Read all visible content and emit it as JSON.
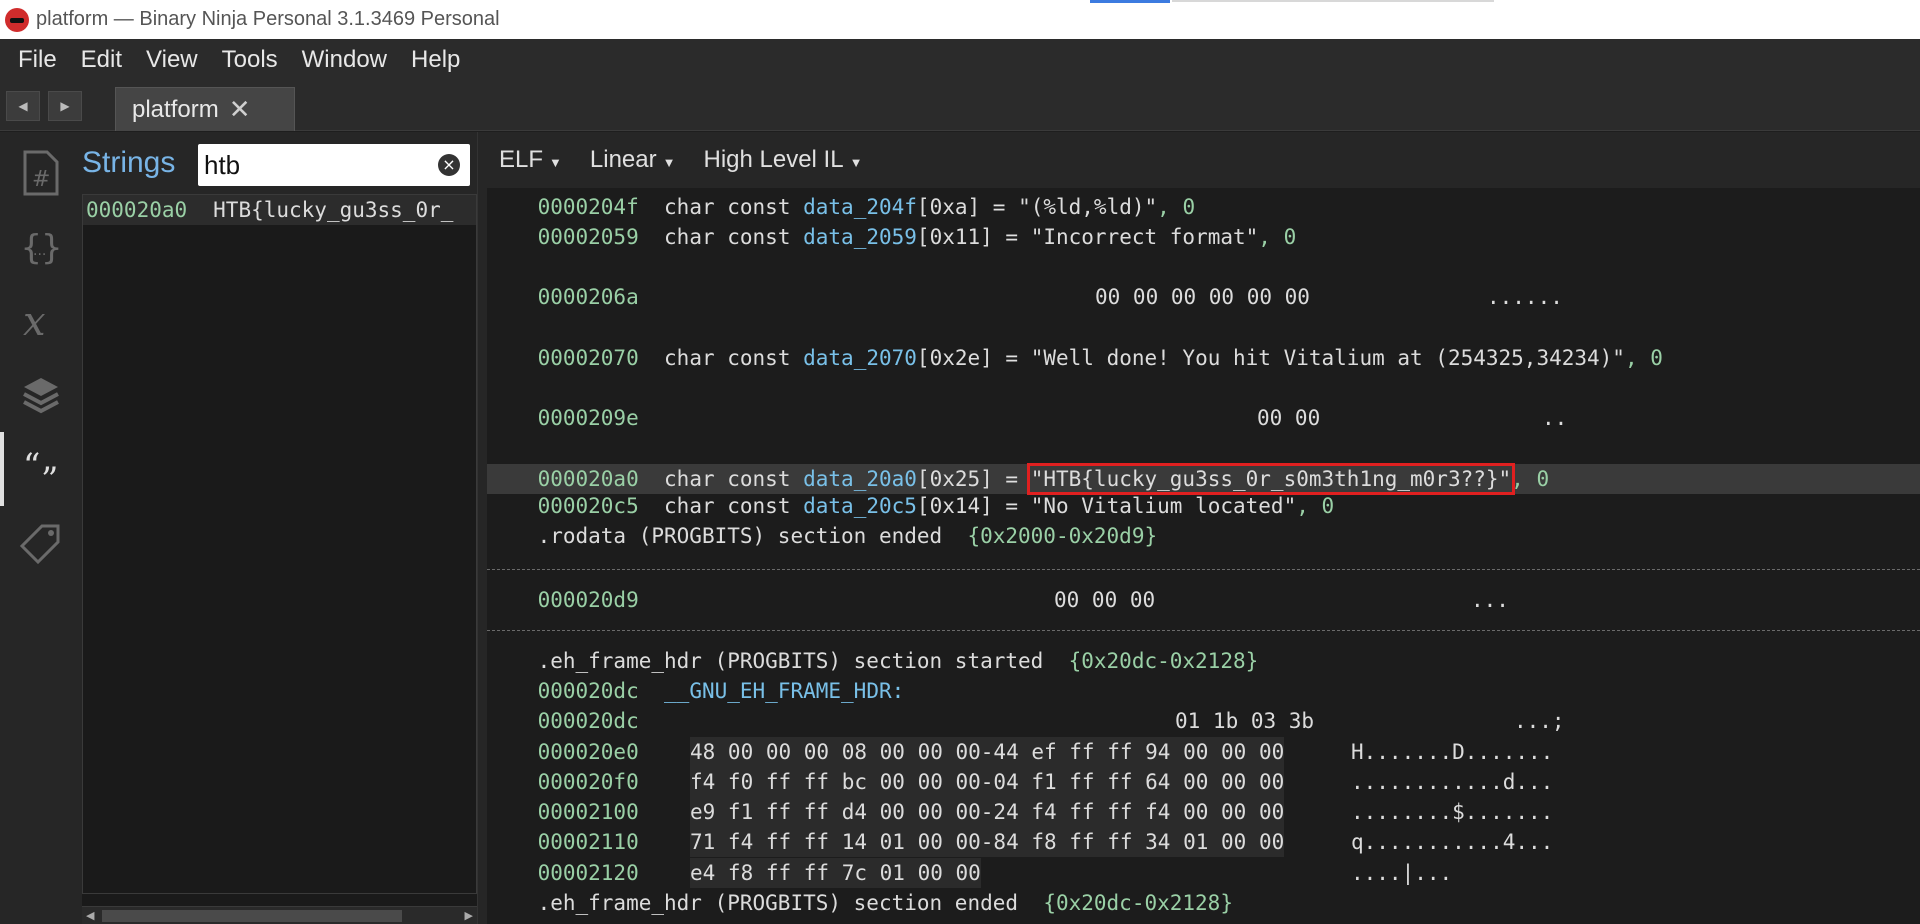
{
  "window": {
    "title": "platform — Binary Ninja Personal 3.1.3469 Personal"
  },
  "menu": [
    "File",
    "Edit",
    "View",
    "Tools",
    "Window",
    "Help"
  ],
  "tab": {
    "label": "platform",
    "close": "✕"
  },
  "nav": {
    "back": "◀",
    "forward": "▶"
  },
  "strings_panel": {
    "title": "Strings",
    "search_value": "htb",
    "results": [
      {
        "address": "000020a0",
        "text": "HTB{lucky_gu3ss_0r_"
      }
    ]
  },
  "toolbar": {
    "format": "ELF",
    "view": "Linear",
    "il": "High Level IL"
  },
  "lines": [
    {
      "addr": "0000204f",
      "decl": "char const",
      "name": "data_204f",
      "size": "[0xa]",
      "value": "\"(%ld,%ld)\"",
      "term": ", 0"
    },
    {
      "addr": "00002059",
      "decl": "char const",
      "name": "data_2059",
      "size": "[0x11]",
      "value": "\"Incorrect format\"",
      "term": ", 0"
    },
    {
      "addr": "0000206a",
      "hex": "00 00 00 00 00 00",
      "ascii": "......"
    },
    {
      "addr": "00002070",
      "decl": "char const",
      "name": "data_2070",
      "size": "[0x2e]",
      "value": "\"Well done! You hit Vitalium at (254325,34234)\"",
      "term": ", 0"
    },
    {
      "addr": "0000209e",
      "hex": "00 00",
      "ascii": ".."
    },
    {
      "addr": "000020a0",
      "decl": "char const",
      "name": "data_20a0",
      "size": "[0x25]",
      "value": "\"HTB{lucky_gu3ss_0r_s0m3th1ng_m0r3??}\"",
      "term": ", 0"
    },
    {
      "addr": "000020c5",
      "decl": "char const",
      "name": "data_20c5",
      "size": "[0x14]",
      "value": "\"No Vitalium located\"",
      "term": ", 0"
    },
    {
      "section_end_rodata": ".rodata (PROGBITS) section ended",
      "range": "{0x2000-0x20d9}"
    },
    {
      "addr": "000020d9",
      "hex": "00 00 00",
      "ascii": "..."
    },
    {
      "section_start_eh": ".eh_frame_hdr (PROGBITS) section started",
      "range": "{0x20dc-0x2128}"
    },
    {
      "addr": "000020dc",
      "label": "__GNU_EH_FRAME_HDR:"
    },
    {
      "addr": "000020dc",
      "hex": "01 1b 03 3b",
      "ascii": "...;"
    },
    {
      "addr": "000020e0",
      "hex": "48 00 00 00 08 00 00 00-44 ef ff ff 94 00 00 00",
      "ascii": "H.......D......."
    },
    {
      "addr": "000020f0",
      "hex": "f4 f0 ff ff bc 00 00 00-04 f1 ff ff 64 00 00 00",
      "ascii": "............d..."
    },
    {
      "addr": "00002100",
      "hex": "e9 f1 ff ff d4 00 00 00-24 f4 ff ff f4 00 00 00",
      "ascii": "........$......."
    },
    {
      "addr": "00002110",
      "hex": "71 f4 ff ff 14 01 00 00-84 f8 ff ff 34 01 00 00",
      "ascii": "q...........4..."
    },
    {
      "addr": "00002120",
      "hex": "e4 f8 ff ff 7c 01 00 00",
      "ascii": "....|..."
    },
    {
      "section_end_eh": ".eh_frame_hdr (PROGBITS) section ended",
      "range": "{0x20dc-0x2128}"
    }
  ],
  "colors": {
    "address": "#9ad0a6",
    "identifier": "#79c0e8",
    "highlight_box": "#e02020",
    "strings_title": "#78b4e6"
  }
}
